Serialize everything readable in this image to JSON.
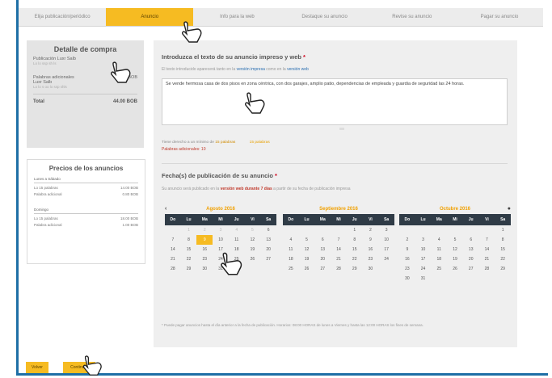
{
  "steps": [
    "Elija publicación/periódico",
    "Anuncio",
    "Info para la web",
    "Destaque su anuncio",
    "Revise su anuncio",
    "Pagar su anuncio"
  ],
  "purchase": {
    "title": "Detalle de compra",
    "rows": [
      {
        "label": "Publicación Luxr Salb",
        "sub": "Lo lo ssp sh ls",
        "value": ""
      },
      {
        "label": "Palabras adicionales Luxr Salb",
        "sub": "Lo lo s oo lo ssp shls",
        "value": "33.00 BOB"
      }
    ],
    "total_label": "Total",
    "total_value": "44.00 BOB"
  },
  "prices": {
    "title": "Precios de los anuncios",
    "groups": [
      {
        "name": "Lunes a Sábado",
        "rows": [
          {
            "label": "Lo 15 palabras",
            "value": "14.00 BOB"
          },
          {
            "label": "Palabra adicional",
            "value": "0.80 BOB"
          }
        ]
      },
      {
        "name": "Domingo",
        "rows": [
          {
            "label": "Lo 15 palabras",
            "value": "18.00 BOB"
          },
          {
            "label": "Palabra adicional",
            "value": "1.00 BOB"
          }
        ]
      }
    ]
  },
  "ad_text": {
    "heading": "Introduzca el texto de su anuncio impreso y web",
    "hint_pre": "El texto introducido aparecerá tanto en la",
    "hint_link1": "versión impresa",
    "hint_mid": "como en la",
    "hint_link2": "versión web",
    "value": "Se vende hermosa casa de dos pisos en zona céntrica, con dos garajes, amplio patio, dependencias de empleada y guardia de seguridad las 24 horas.",
    "counter_pre": "Tiene derecho a un mínimo de",
    "counter_count": "15 palabras",
    "counter_used": "15 palabras",
    "extra_words": "Palabras adicionales: 10"
  },
  "dates": {
    "heading": "Fecha(s) de publicación de su anuncio",
    "hint_pre": "Su anuncio será publicado en la",
    "hint_bold": "versión web durante 7 días",
    "hint_post": "a partir de su fecha de publicación impresa",
    "weekdays": [
      "Do",
      "Lu",
      "Ma",
      "Mi",
      "Ju",
      "Vi",
      "Sa"
    ],
    "months": [
      {
        "name": "Agosto 2016",
        "days": [
          [
            "",
            "1",
            "2",
            "3",
            "4",
            "5",
            "6"
          ],
          [
            "7",
            "8",
            "9",
            "10",
            "11",
            "12",
            "13"
          ],
          [
            "14",
            "15",
            "16",
            "17",
            "18",
            "19",
            "20"
          ],
          [
            "21",
            "22",
            "23",
            "24",
            "25",
            "26",
            "27"
          ],
          [
            "28",
            "29",
            "30",
            "31",
            "",
            "",
            ""
          ]
        ],
        "selected": "9",
        "muted_before": "6"
      },
      {
        "name": "Septiembre 2016",
        "days": [
          [
            "",
            "",
            "",
            "",
            "1",
            "2",
            "3"
          ],
          [
            "4",
            "5",
            "6",
            "7",
            "8",
            "9",
            "10"
          ],
          [
            "11",
            "12",
            "13",
            "14",
            "15",
            "16",
            "17"
          ],
          [
            "18",
            "19",
            "20",
            "21",
            "22",
            "23",
            "24"
          ],
          [
            "25",
            "26",
            "27",
            "28",
            "29",
            "30",
            ""
          ]
        ]
      },
      {
        "name": "Octubre 2016",
        "days": [
          [
            "",
            "",
            "",
            "",
            "",
            "",
            "1"
          ],
          [
            "2",
            "3",
            "4",
            "5",
            "6",
            "7",
            "8"
          ],
          [
            "9",
            "10",
            "11",
            "12",
            "13",
            "14",
            "15"
          ],
          [
            "16",
            "17",
            "18",
            "19",
            "20",
            "21",
            "22"
          ],
          [
            "23",
            "24",
            "25",
            "26",
            "27",
            "28",
            "29"
          ],
          [
            "30",
            "31",
            "",
            "",
            "",
            "",
            ""
          ]
        ]
      }
    ],
    "prev_icon": "chevron-left-icon",
    "next_icon": "chevron-right-icon",
    "footnote": "* Puede pagar anuncios hasta el día anterior a la fecha de publicación. Horarios: 08:00 HORAS de lunes a Viernes y hasta las 12:00 HORAS los fines de semana."
  },
  "buttons": {
    "back": "Volver",
    "continue": "Continuar"
  },
  "colors": {
    "accent": "#f6bb22",
    "frame": "#1e6fa6",
    "calendar_header": "#2f3b46"
  }
}
